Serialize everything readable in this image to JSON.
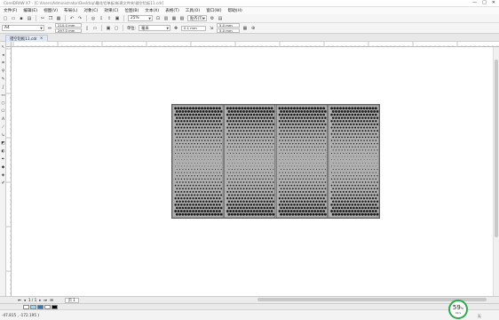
{
  "app": {
    "title": "CorelDRAW X7 - [C:\\Users\\Administrator\\Desktop\\雕花铝单板\\新建文件夹\\镂空铝板11.cdr]",
    "window_controls": [
      "—",
      "□",
      "✕"
    ]
  },
  "menu": [
    "文件(F)",
    "编辑(E)",
    "视图(V)",
    "布局(L)",
    "对象(C)",
    "效果(C)",
    "位图(B)",
    "文本(X)",
    "表格(T)",
    "工具(O)",
    "窗口(W)",
    "帮助(H)"
  ],
  "std_toolbar": {
    "zoom_value": "25%",
    "snap_label": "贴齐(T)"
  },
  "prop_toolbar": {
    "paper_preset": "A4",
    "width": "210.0 mm",
    "height": "297.0 mm",
    "units_label": "单位:",
    "units_value": "毫米",
    "nudge": "0.1 mm",
    "dup_x": "5.0 mm",
    "dup_y": "5.0 mm"
  },
  "document_tab": {
    "label": "镂空铝板11.cdr",
    "close": "×"
  },
  "page_nav": {
    "counter": "1 / 1",
    "page_label": "页 1"
  },
  "palette_colors": [
    "#ffffff",
    "#9ed7f2",
    "#2a7ab8",
    "#ffffff",
    "#000000"
  ],
  "status": {
    "coordinates": "-47.815 , -172.195 )",
    "right_text": "无"
  },
  "gauge": {
    "percent": "59",
    "percent_sign": "%",
    "speed": "0K/s"
  }
}
